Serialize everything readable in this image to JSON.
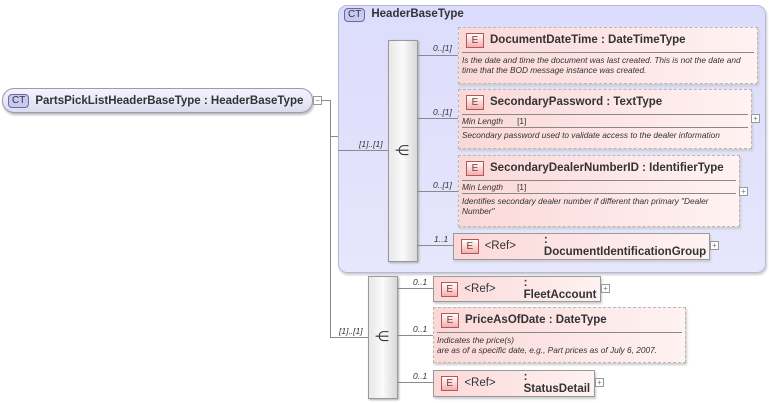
{
  "root": {
    "badge": "CT",
    "name": "PartsPickListHeaderBaseType : HeaderBaseType",
    "toggle": "−"
  },
  "group": {
    "badge": "CT",
    "name": "HeaderBaseType",
    "sequence_occurrence": "[1]..[1]"
  },
  "sequence2": {
    "occurrence": "[1]..[1]"
  },
  "facet_label": "Min Length",
  "elements": [
    {
      "occ": "0..[1]",
      "name": "DocumentDateTime",
      "type": ": DateTimeType",
      "doc": "Is the date and time the document was last created. This is not the date and time that the BOD message instance was created."
    },
    {
      "occ": "0..[1]",
      "name": "SecondaryPassword",
      "type": ": TextType",
      "facet_value": "[1]",
      "doc": "Secondary password used to validate access to the dealer information"
    },
    {
      "occ": "0..[1]",
      "name": "SecondaryDealerNumberID",
      "type": ": IdentifierType",
      "facet_value": "[1]",
      "doc": "Identifies secondary dealer number if different than primary \"Dealer Number\""
    },
    {
      "occ": "1..1",
      "name": "<Ref>",
      "type": ": DocumentIdentificationGroup"
    },
    {
      "occ": "0..1",
      "name": "<Ref>",
      "type": ": FleetAccount"
    },
    {
      "occ": "0..1",
      "name": "PriceAsOfDate",
      "type": ": DateType",
      "doc": "Indicates the price(s)\nare as of a specific date, e.g., Part prices as of July 6, 2007."
    },
    {
      "occ": "0..1",
      "name": "<Ref>",
      "type": ": StatusDetail"
    }
  ],
  "badge_e": "E",
  "expand": "+",
  "seq_icon": "sequence-icon"
}
